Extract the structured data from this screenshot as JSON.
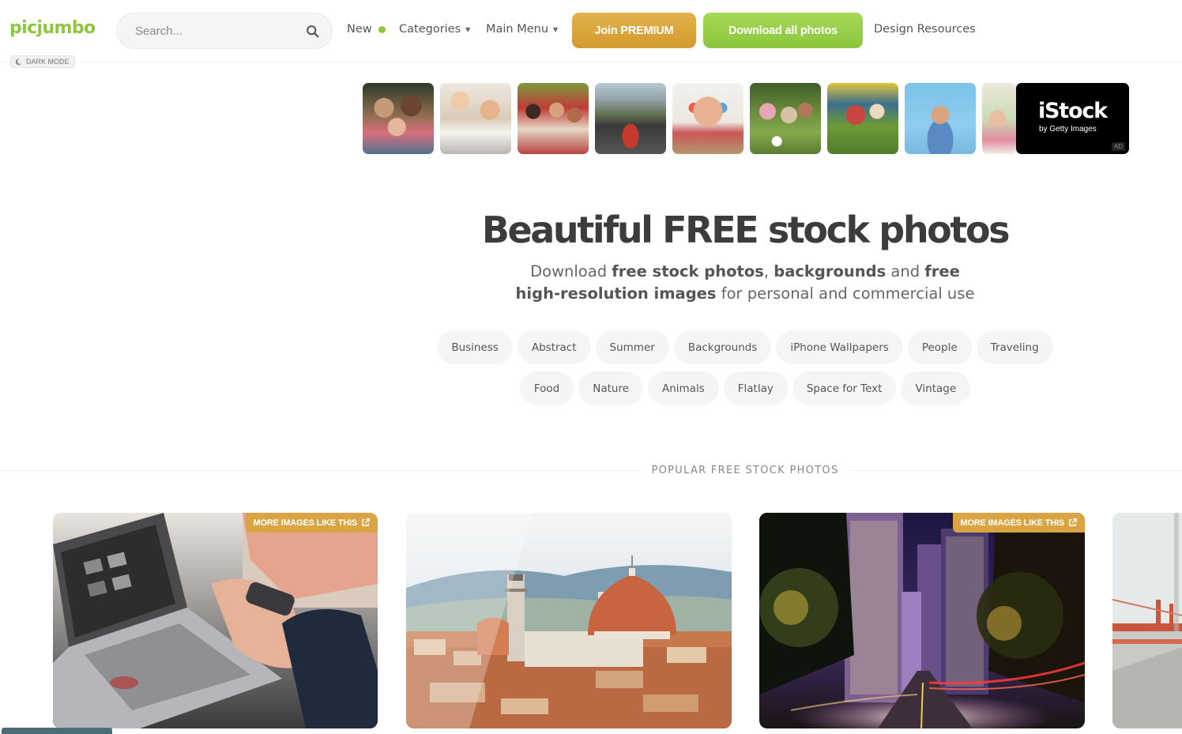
{
  "header": {
    "logo": "picjumbo",
    "dark_mode_label": "DARK MODE",
    "search_placeholder": "Search...",
    "nav": {
      "new_label": "New",
      "categories_label": "Categories",
      "main_menu_label": "Main Menu",
      "design_resources_label": "Design Resources"
    },
    "join_premium_label": "Join PREMIUM",
    "download_all_label": "Download all photos"
  },
  "ad": {
    "brand": "iStock",
    "brand_sub": "by Getty Images",
    "badge": "AD",
    "thumb_count": 8
  },
  "hero": {
    "title": "Beautiful FREE stock photos",
    "sub_1": "Download ",
    "sub_2": "free stock photos",
    "sub_3": ", ",
    "sub_4": "backgrounds",
    "sub_5": " and ",
    "sub_6": "free high-resolution images",
    "sub_7": " for personal and commercial use"
  },
  "tags_row1": [
    "Business",
    "Abstract",
    "Summer",
    "Backgrounds",
    "iPhone Wallpapers",
    "People",
    "Traveling"
  ],
  "tags_row2": [
    "Food",
    "Nature",
    "Animals",
    "Flatlay",
    "Space for Text",
    "Vintage"
  ],
  "section": {
    "title": "POPULAR FREE STOCK PHOTOS",
    "more_images_label": "MORE IMAGES LIKE THIS"
  },
  "colors": {
    "brand_green": "#8dc63f",
    "premium_orange": "#d9a441",
    "text_dark": "#3c3c3c"
  }
}
